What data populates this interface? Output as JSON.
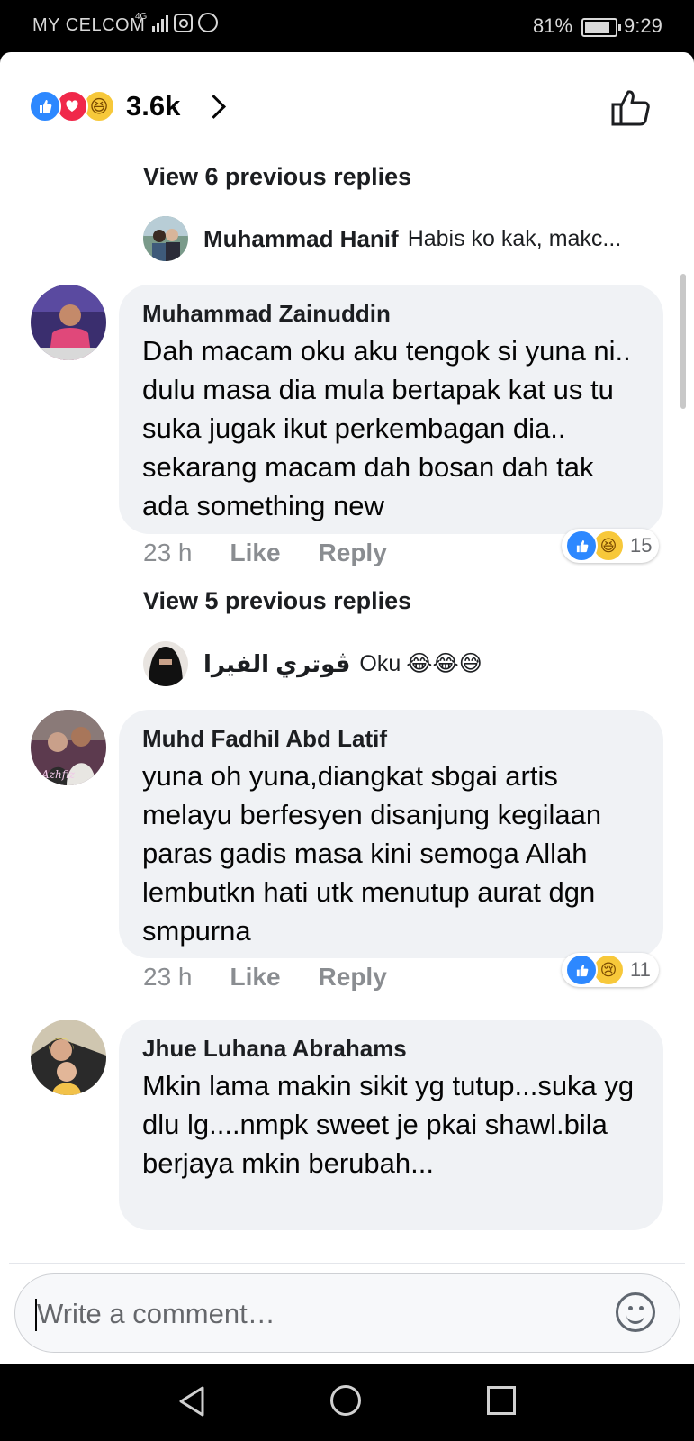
{
  "status_bar": {
    "carrier": "MY CELCOM",
    "network": "4G",
    "battery": "81%",
    "time": "9:29",
    "icons": [
      "signal-icon",
      "instagram-icon",
      "whatsapp-icon",
      "battery-icon"
    ]
  },
  "header": {
    "reaction_icons": [
      "like",
      "love",
      "haha"
    ],
    "reaction_count": "3.6k",
    "like_button_icon": "thumbs-up-outline-icon"
  },
  "threads": [
    {
      "view_previous": "View 6 previous replies",
      "reply_preview": {
        "name": "Muhammad Hanif",
        "text": "Habis ko kak, makc..."
      }
    },
    {
      "view_previous": "View 5 previous replies",
      "reply_preview": {
        "name": "ڤوتري الفيرا",
        "text": "Oku",
        "emoji": "😂😂😅"
      }
    }
  ],
  "comments": [
    {
      "name": "Muhammad Zainuddin",
      "text": "Dah macam oku aku tengok si yuna ni.. dulu masa dia mula bertapak kat us tu suka jugak ikut perkembagan dia.. sekarang macam dah bosan dah tak ada something new",
      "time": "23 h",
      "like_label": "Like",
      "reply_label": "Reply",
      "reactions": [
        "like",
        "haha"
      ],
      "reaction_count": "15"
    },
    {
      "name": "Muhd Fadhil Abd Latif",
      "text": "yuna oh yuna,diangkat sbgai artis melayu berfesyen disanjung kegilaan paras gadis masa kini semoga Allah lembutkn hati utk menutup aurat dgn smpurna",
      "time": "23 h",
      "like_label": "Like",
      "reply_label": "Reply",
      "reactions": [
        "like",
        "sad"
      ],
      "reaction_count": "11"
    },
    {
      "name": "Jhue Luhana Abrahams",
      "text": "Mkin lama makin sikit yg tutup...suka yg dlu lg....nmpk sweet je pkai shawl.bila berjaya mkin berubah..."
    }
  ],
  "composer": {
    "placeholder": "Write a comment…",
    "emoji_icon": "emoji-smile-icon"
  },
  "nav_bar": {
    "icons": [
      "back-icon",
      "home-icon",
      "recents-icon"
    ]
  },
  "colors": {
    "like_blue": "#2d88ff",
    "love_red": "#f0284a",
    "emoji_yellow": "#f7c83a",
    "bubble_bg": "#f0f2f5",
    "meta_gray": "#8a8d91"
  }
}
